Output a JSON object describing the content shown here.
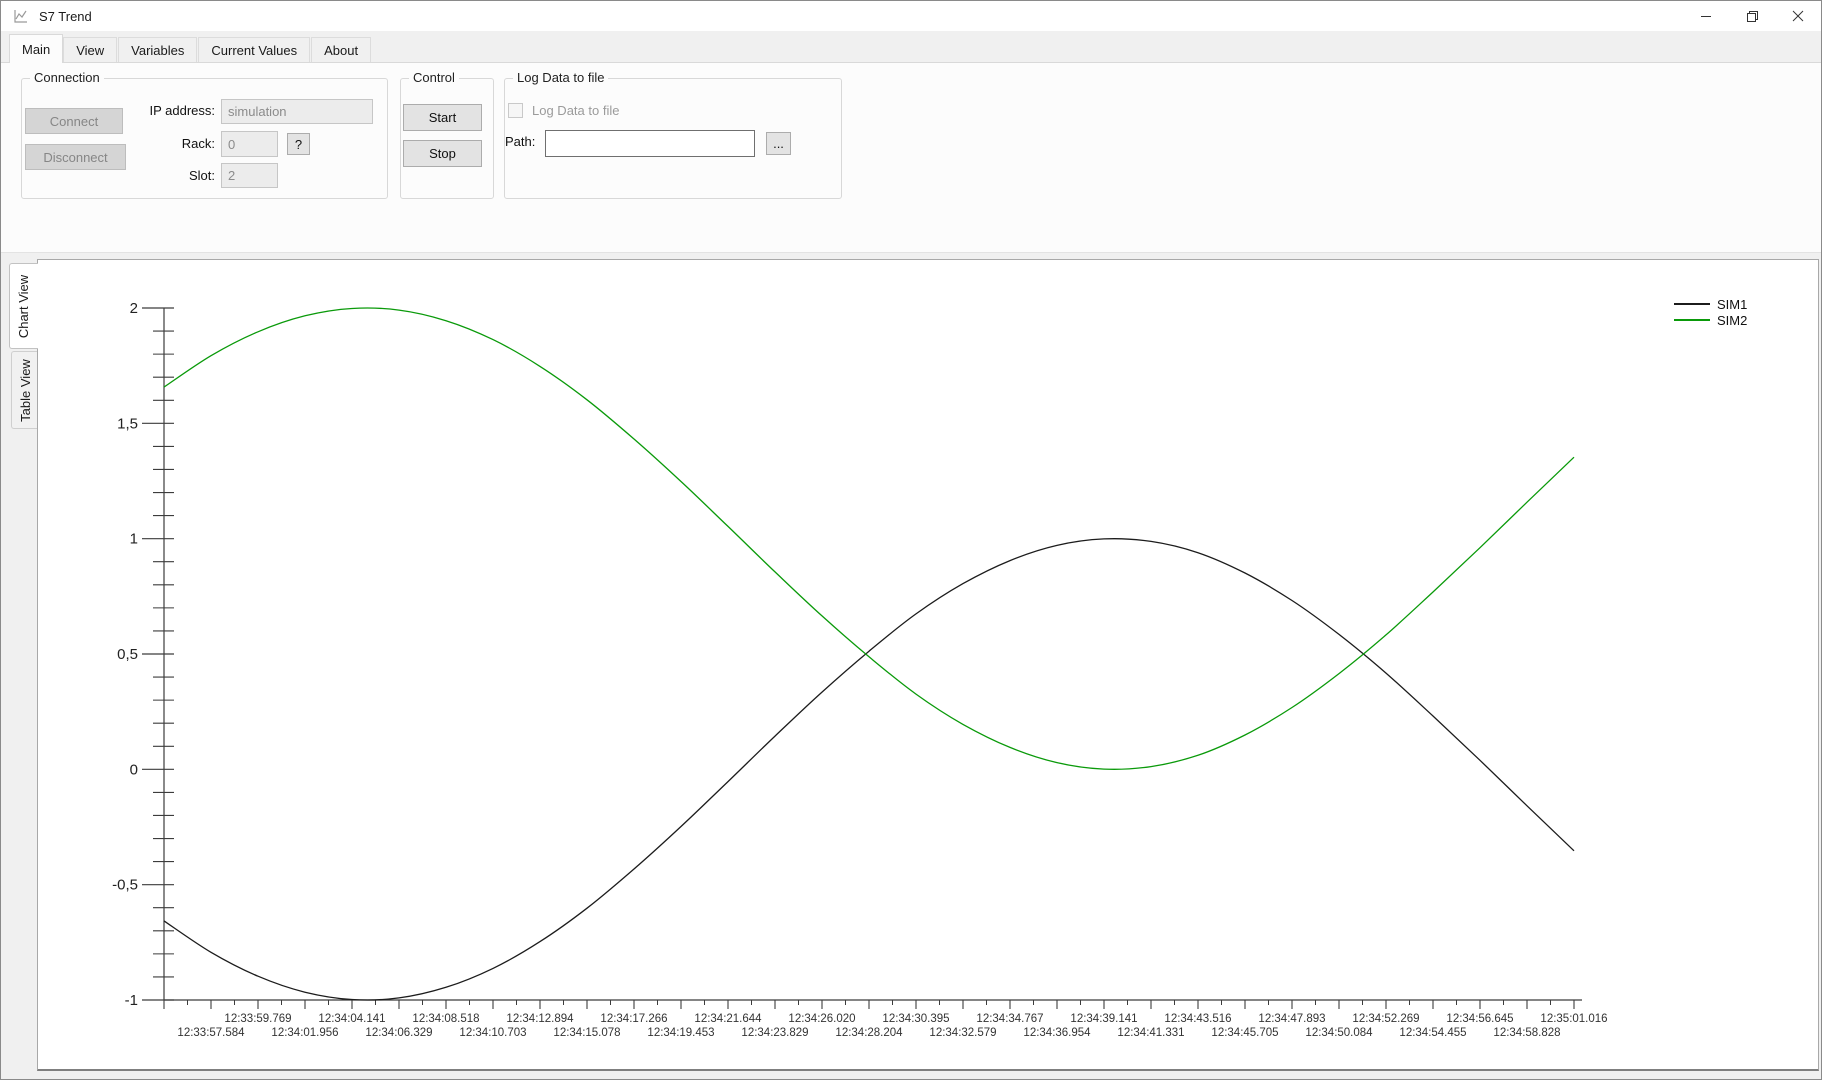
{
  "window": {
    "title": "S7 Trend"
  },
  "tabs": [
    "Main",
    "View",
    "Variables",
    "Current Values",
    "About"
  ],
  "active_tab": "Main",
  "main_tab": {
    "connection": {
      "title": "Connection",
      "connect": "Connect",
      "disconnect": "Disconnect",
      "ip_label": "IP address:",
      "ip_value": "simulation",
      "rack_label": "Rack:",
      "rack_value": "0",
      "rack_help": "?",
      "slot_label": "Slot:",
      "slot_value": "2"
    },
    "control": {
      "title": "Control",
      "start": "Start",
      "stop": "Stop"
    },
    "log": {
      "title": "Log Data to file",
      "checkbox_label": "Log Data to file",
      "checkbox_checked": false,
      "path_label": "Path:",
      "path_value": "",
      "browse": "..."
    }
  },
  "side_tabs": [
    "Chart View",
    "Table View"
  ],
  "active_side_tab": "Chart View",
  "chart_data": {
    "type": "line",
    "title": "",
    "grid": false,
    "legend_position": "top-right",
    "ylim": [
      -1,
      2
    ],
    "y_major_step": 0.5,
    "y_minor_step": 0.1,
    "y_tick_labels": [
      "2",
      "1,5",
      "1",
      "0,5",
      "0",
      "-0,5",
      "-1"
    ],
    "x_tick_labels": [
      "12:33:57.584",
      "12:33:59.769",
      "12:34:01.956",
      "12:34:04.141",
      "12:34:06.329",
      "12:34:08.518",
      "12:34:10.703",
      "12:34:12.894",
      "12:34:15.078",
      "12:34:17.266",
      "12:34:19.453",
      "12:34:21.644",
      "12:34:23.829",
      "12:34:26.020",
      "12:34:28.204",
      "12:34:30.395",
      "12:34:32.579",
      "12:34:34.767",
      "12:34:36.954",
      "12:34:39.141",
      "12:34:41.331",
      "12:34:43.516",
      "12:34:45.705",
      "12:34:47.893",
      "12:34:50.084",
      "12:34:52.269",
      "12:34:54.455",
      "12:34:56.645",
      "12:34:58.828",
      "12:35:01.016"
    ],
    "x_label_layout": "staggered: first label in lower row, alternating",
    "values_note": "values[0] is at the unlabeled axis-origin tick; values[1..30] align with x_tick_labels",
    "series": [
      {
        "name": "SIM1",
        "color": "#1c1c1c",
        "values": [
          -0.657,
          -0.793,
          -0.897,
          -0.966,
          -0.998,
          -0.991,
          -0.945,
          -0.863,
          -0.747,
          -0.602,
          -0.432,
          -0.248,
          -0.053,
          0.144,
          0.335,
          0.512,
          0.674,
          0.805,
          0.905,
          0.971,
          0.999,
          0.988,
          0.939,
          0.851,
          0.732,
          0.585,
          0.417,
          0.231,
          0.039,
          -0.158,
          -0.353
        ]
      },
      {
        "name": "SIM2",
        "color": "#0a9a0a",
        "values": [
          1.657,
          1.793,
          1.897,
          1.966,
          1.998,
          1.991,
          1.945,
          1.863,
          1.747,
          1.602,
          1.432,
          1.248,
          1.053,
          0.856,
          0.665,
          0.488,
          0.326,
          0.195,
          0.095,
          0.029,
          0.001,
          0.012,
          0.061,
          0.149,
          0.268,
          0.415,
          0.583,
          0.769,
          0.961,
          1.158,
          1.353
        ]
      }
    ]
  }
}
